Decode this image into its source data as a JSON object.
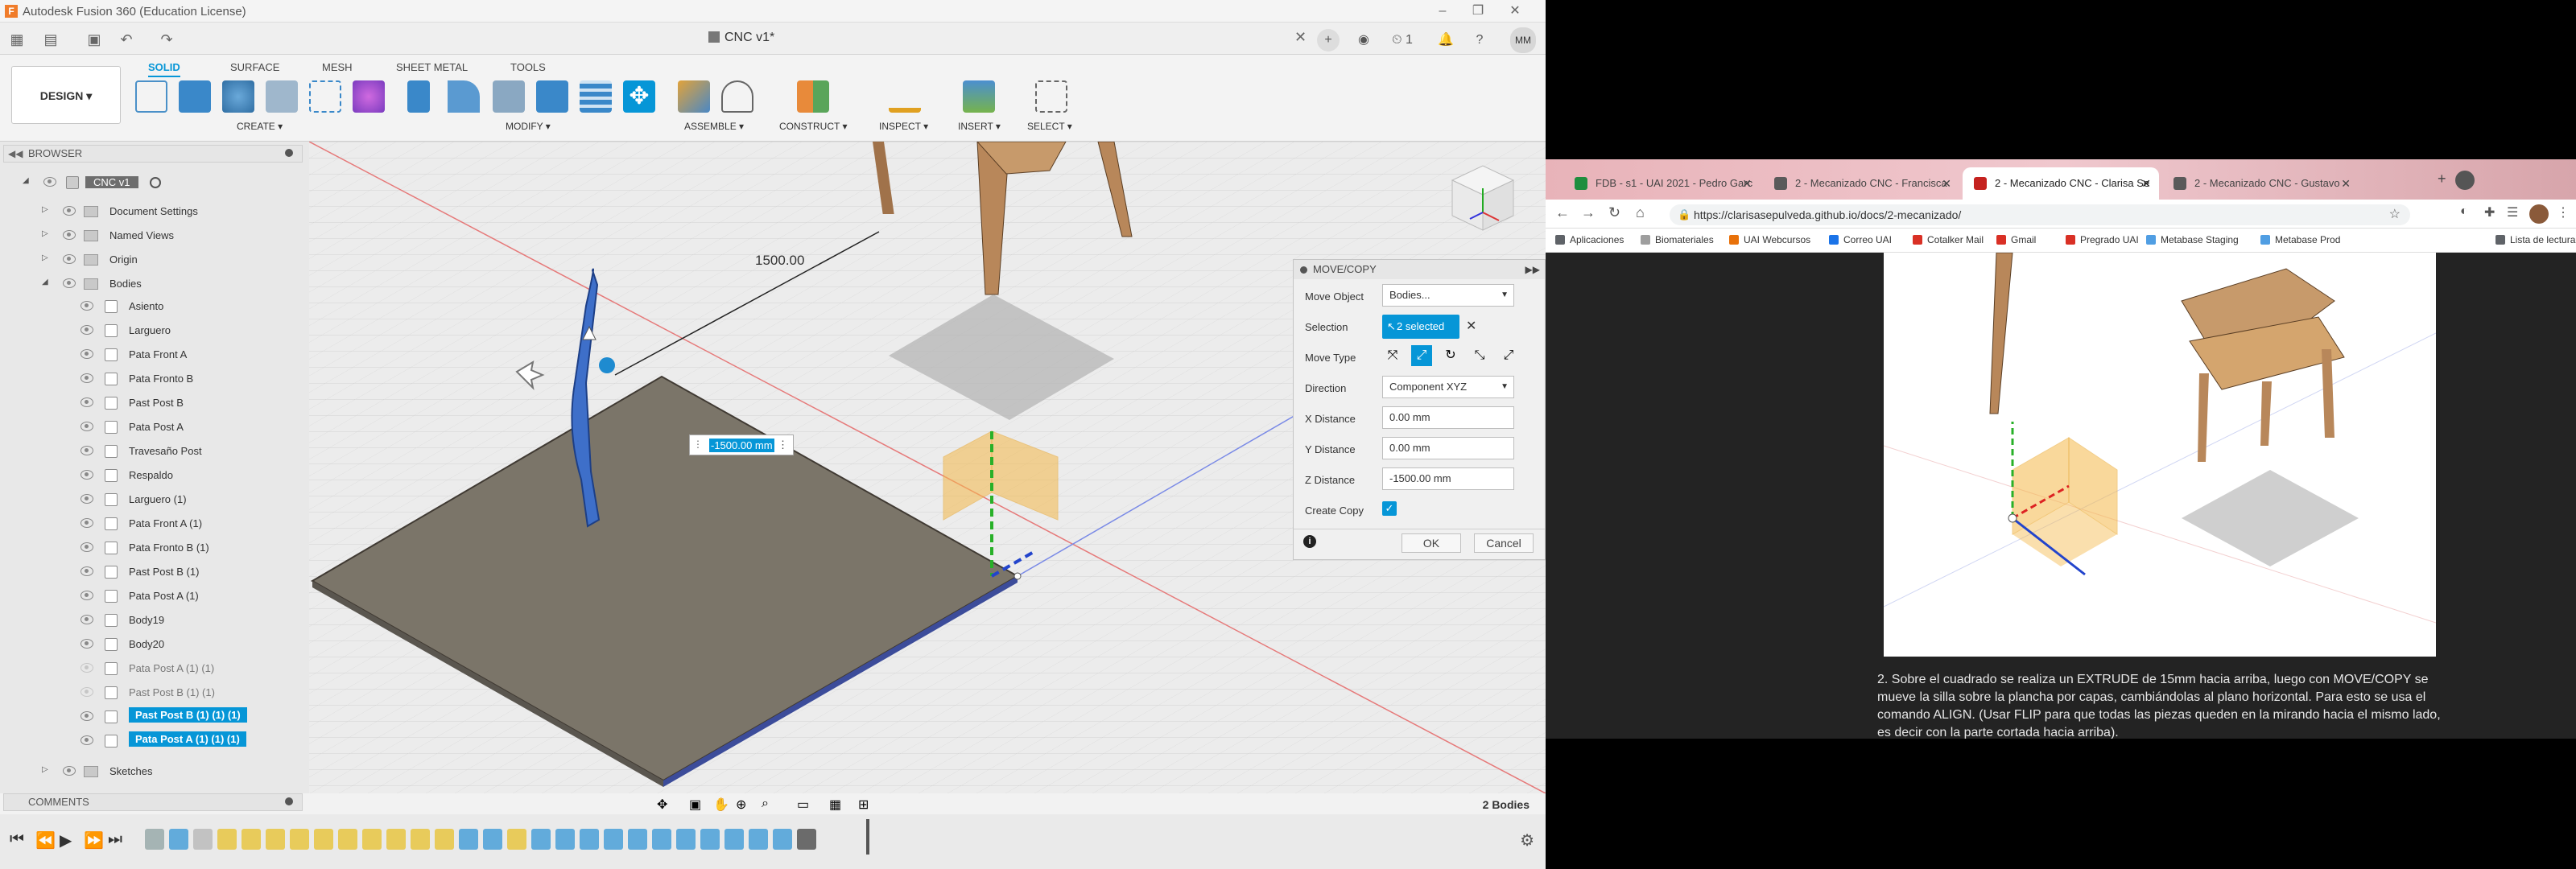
{
  "fusion": {
    "window_title": "Autodesk Fusion 360 (Education License)",
    "document_tab": "CNC v1*",
    "avatar_initials": "MM",
    "job_count": "1",
    "ribbon_tabs": [
      "SOLID",
      "SURFACE",
      "MESH",
      "SHEET METAL",
      "TOOLS"
    ],
    "workspace": "DESIGN ▾",
    "ribbon_groups": [
      "CREATE ▾",
      "MODIFY ▾",
      "ASSEMBLE ▾",
      "CONSTRUCT ▾",
      "INSPECT ▾",
      "INSERT ▾",
      "SELECT ▾"
    ],
    "browser": {
      "header": "BROWSER",
      "root": "CNC v1",
      "items": [
        {
          "label": "Document Settings"
        },
        {
          "label": "Named Views"
        },
        {
          "label": "Origin"
        },
        {
          "label": "Bodies"
        }
      ],
      "bodies": [
        {
          "label": "Asiento"
        },
        {
          "label": "Larguero"
        },
        {
          "label": "Pata Front A"
        },
        {
          "label": "Pata Fronto B"
        },
        {
          "label": "Past Post B"
        },
        {
          "label": "Pata Post A"
        },
        {
          "label": "Travesaño Post"
        },
        {
          "label": "Respaldo"
        },
        {
          "label": "Larguero (1)"
        },
        {
          "label": "Pata Front A (1)"
        },
        {
          "label": "Pata Fronto B (1)"
        },
        {
          "label": "Past Post B (1)"
        },
        {
          "label": "Pata Post A (1)"
        },
        {
          "label": "Body19"
        },
        {
          "label": "Body20"
        },
        {
          "label": "Pata Post A (1) (1)"
        },
        {
          "label": "Past Post B (1) (1)"
        },
        {
          "label": "Past Post B (1) (1) (1)"
        },
        {
          "label": "Pata Post A (1) (1) (1)"
        }
      ],
      "sketches": "Sketches"
    },
    "viewport": {
      "dimension_label": "1500.00",
      "input_value": "-1500.00 mm"
    },
    "move_copy": {
      "title": "MOVE/COPY",
      "move_object_label": "Move Object",
      "move_object_value": "Bodies...",
      "selection_label": "Selection",
      "selection_value": "2 selected",
      "move_type_label": "Move Type",
      "direction_label": "Direction",
      "direction_value": "Component XYZ",
      "x_label": "X Distance",
      "x_value": "0.00 mm",
      "y_label": "Y Distance",
      "y_value": "0.00 mm",
      "z_label": "Z Distance",
      "z_value": "-1500.00 mm",
      "create_copy_label": "Create Copy",
      "create_copy_checked": true,
      "ok": "OK",
      "cancel": "Cancel"
    },
    "comments": "COMMENTS",
    "bodies_count": "2 Bodies"
  },
  "chrome": {
    "tabs": [
      {
        "label": "FDB - s1 - UAI 2021 - Pedro Garc",
        "color": "#1e8e3e"
      },
      {
        "label": "2 - Mecanizado CNC - Francisca",
        "color": "#5a5a5a"
      },
      {
        "label": "2 - Mecanizado CNC - Clarisa Se",
        "color": "#c5221f"
      },
      {
        "label": "2 - Mecanizado CNC - Gustavo",
        "color": "#5a5a5a"
      }
    ],
    "url": "https://clarisasepulveda.github.io/docs/2-mecanizado/",
    "bookmarks": [
      {
        "label": "Aplicaciones",
        "color": "#5f6368"
      },
      {
        "label": "Biomateriales",
        "color": "#9e9e9e"
      },
      {
        "label": "UAI Webcursos",
        "color": "#e8710a"
      },
      {
        "label": "Correo UAI",
        "color": "#1a73e8"
      },
      {
        "label": "Cotalker Mail",
        "color": "#d93025"
      },
      {
        "label": "Gmail",
        "color": "#d93025"
      },
      {
        "label": "Pregrado UAI",
        "color": "#d93025"
      },
      {
        "label": "Metabase Staging",
        "color": "#509ee3"
      },
      {
        "label": "Metabase Prod",
        "color": "#509ee3"
      },
      {
        "label": "Lista de lectura",
        "color": "#5f6368"
      }
    ],
    "page_text": "2. Sobre el cuadrado se realiza un EXTRUDE de 15mm hacia arriba, luego con MOVE/COPY se mueve la silla sobre la plancha por capas, cambiándolas al plano horizontal. Para esto se usa el comando ALIGN. (Usar FLIP para que todas las piezas queden en la mirando hacia el mismo lado, es decir con la parte cortada hacia arriba)."
  }
}
